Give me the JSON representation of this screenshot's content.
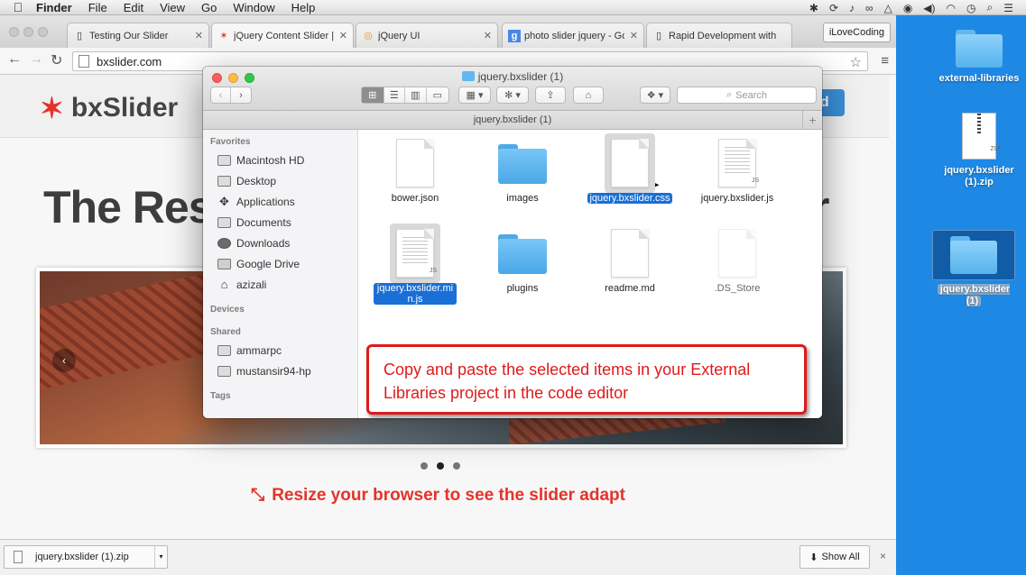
{
  "menubar": {
    "app": "Finder",
    "items": [
      "File",
      "Edit",
      "View",
      "Go",
      "Window",
      "Help"
    ],
    "status_icons": [
      "bluetooth-icon",
      "sync-icon",
      "notification-bell-icon",
      "creative-cloud-icon",
      "drive-icon",
      "record-icon",
      "volume-icon",
      "wifi-icon",
      "clock-icon",
      "spotlight-search-icon",
      "notification-center-icon"
    ]
  },
  "browser": {
    "tabs": [
      {
        "title": "Testing Our Slider",
        "icon": "page-icon"
      },
      {
        "title": "jQuery Content Slider | R",
        "icon": "bxslider-star-icon"
      },
      {
        "title": "jQuery UI",
        "icon": "jquery-ui-icon"
      },
      {
        "title": "photo slider jquery - Goo",
        "icon": "google-icon"
      },
      {
        "title": "Rapid Development with",
        "icon": "page-icon"
      }
    ],
    "profile": "iLoveCoding",
    "url": "bxslider.com"
  },
  "site": {
    "logo": "bxSlider",
    "download_btn": "ad",
    "hero_left": "The Res",
    "hero_right": "r",
    "resize_tip": "Resize your browser to see the slider adapt",
    "slider_prev": "‹"
  },
  "shelf": {
    "file": "jquery.bxslider (1).zip",
    "show_all": "Show All",
    "close": "×"
  },
  "finder": {
    "title": "jquery.bxslider (1)",
    "path_title": "jquery.bxslider (1)",
    "search_placeholder": "Search",
    "sidebar": {
      "favorites_header": "Favorites",
      "favorites": [
        {
          "label": "Macintosh HD",
          "icon": "hard-drive-icon"
        },
        {
          "label": "Desktop",
          "icon": "desktop-icon"
        },
        {
          "label": "Applications",
          "icon": "applications-icon"
        },
        {
          "label": "Documents",
          "icon": "documents-icon"
        },
        {
          "label": "Downloads",
          "icon": "downloads-icon"
        },
        {
          "label": "Google Drive",
          "icon": "folder-icon"
        },
        {
          "label": "azizali",
          "icon": "home-icon"
        }
      ],
      "devices_header": "Devices",
      "shared_header": "Shared",
      "shared": [
        {
          "label": "ammarpc",
          "icon": "computer-icon"
        },
        {
          "label": "mustansir94-hp",
          "icon": "computer-icon"
        }
      ],
      "tags_header": "Tags"
    },
    "files": [
      {
        "name": "bower.json",
        "kind": "doc",
        "selected": false
      },
      {
        "name": "images",
        "kind": "folder",
        "selected": false
      },
      {
        "name": "jquery.bxslider.css",
        "kind": "doc",
        "selected": true
      },
      {
        "name": "jquery.bxslider.js",
        "kind": "js",
        "tag": "JS",
        "selected": false
      },
      {
        "name": "jquery.bxslider.min.js",
        "kind": "js",
        "tag": "JS",
        "selected": true
      },
      {
        "name": "plugins",
        "kind": "folder",
        "selected": false
      },
      {
        "name": "readme.md",
        "kind": "doc",
        "selected": false
      },
      {
        "name": ".DS_Store",
        "kind": "ghost",
        "selected": false
      }
    ]
  },
  "desktop": {
    "items": [
      {
        "name": "external-libraries",
        "kind": "folder"
      },
      {
        "name": "jquery.bxslider (1).zip",
        "kind": "zip",
        "tag": "ZIP"
      },
      {
        "name": "jquery.bxslider (1)",
        "kind": "folder",
        "selected": true
      }
    ]
  },
  "callout": {
    "text": "Copy and paste the selected items in your External Libraries project in the code editor"
  },
  "colors": {
    "desktop": "#1e88e5",
    "selection": "#1a6fd6",
    "accent_red": "#e5332a",
    "callout_red": "#e01a1a"
  }
}
